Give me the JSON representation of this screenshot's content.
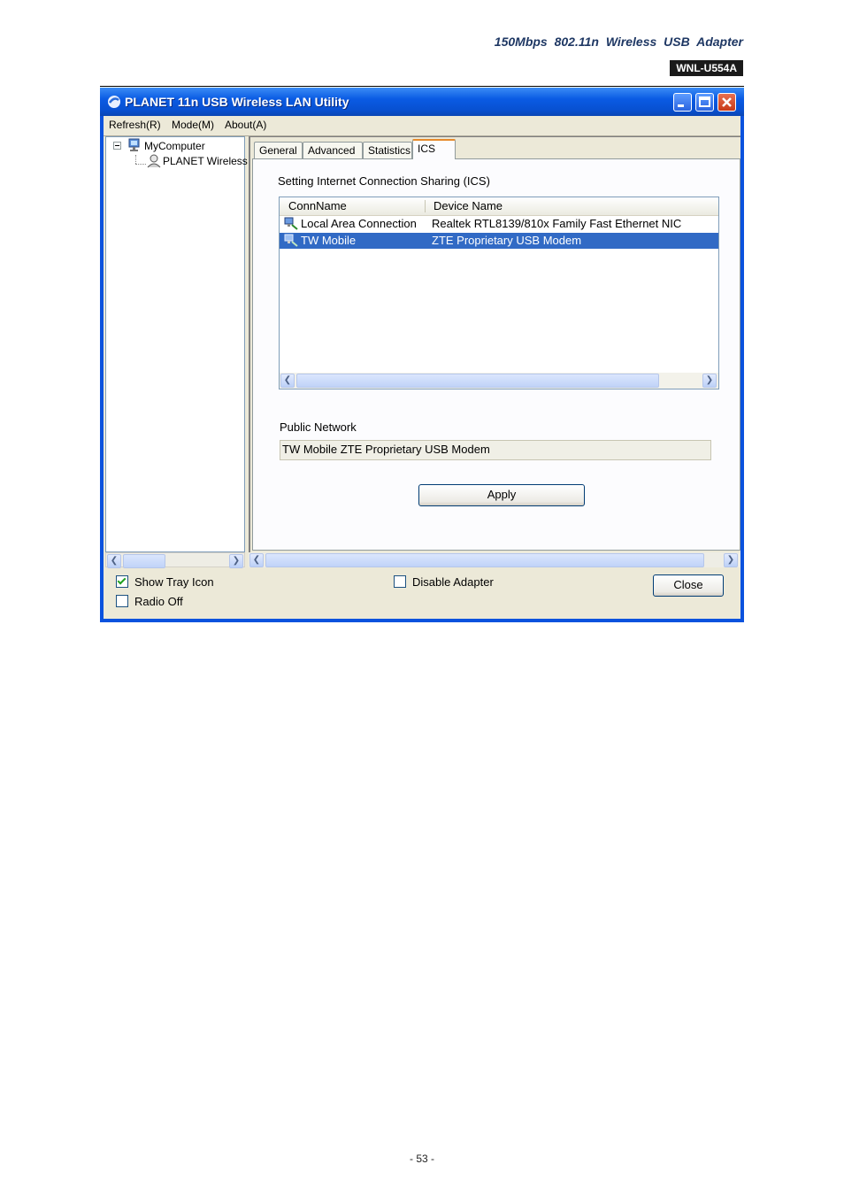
{
  "document": {
    "header_title": "150Mbps 802.11n Wireless USB Adapter",
    "model": "WNL-U554A",
    "page_number": "- 53 -"
  },
  "window": {
    "title": "PLANET 11n USB Wireless LAN Utility",
    "menu": [
      "Refresh(R)",
      "Mode(M)",
      "About(A)"
    ],
    "tree": {
      "root": "MyComputer",
      "child": "PLANET Wireless"
    },
    "tabs": [
      "General",
      "Advanced",
      "Statistics",
      "ICS"
    ],
    "active_tab": "ICS",
    "ics": {
      "section_title": "Setting Internet Connection Sharing (ICS)",
      "columns": [
        "ConnName",
        "Device Name"
      ],
      "rows": [
        {
          "conn": "Local Area Connection",
          "device": "Realtek RTL8139/810x Family Fast Ethernet NIC",
          "selected": false
        },
        {
          "conn": "TW Mobile",
          "device": "ZTE Proprietary USB Modem",
          "selected": true
        }
      ],
      "public_network_label": "Public Network",
      "public_network_value": "TW Mobile ZTE Proprietary USB Modem",
      "apply_label": "Apply"
    },
    "bottom": {
      "show_tray_icon": {
        "label": "Show Tray Icon",
        "checked": true
      },
      "radio_off": {
        "label": "Radio Off",
        "checked": false
      },
      "disable_adapter": {
        "label": "Disable Adapter",
        "checked": false
      },
      "close_label": "Close"
    }
  },
  "colors": {
    "title_bar": "#0a5be4",
    "selection": "#316ac5",
    "active_tab_accent": "#e68b2c"
  }
}
